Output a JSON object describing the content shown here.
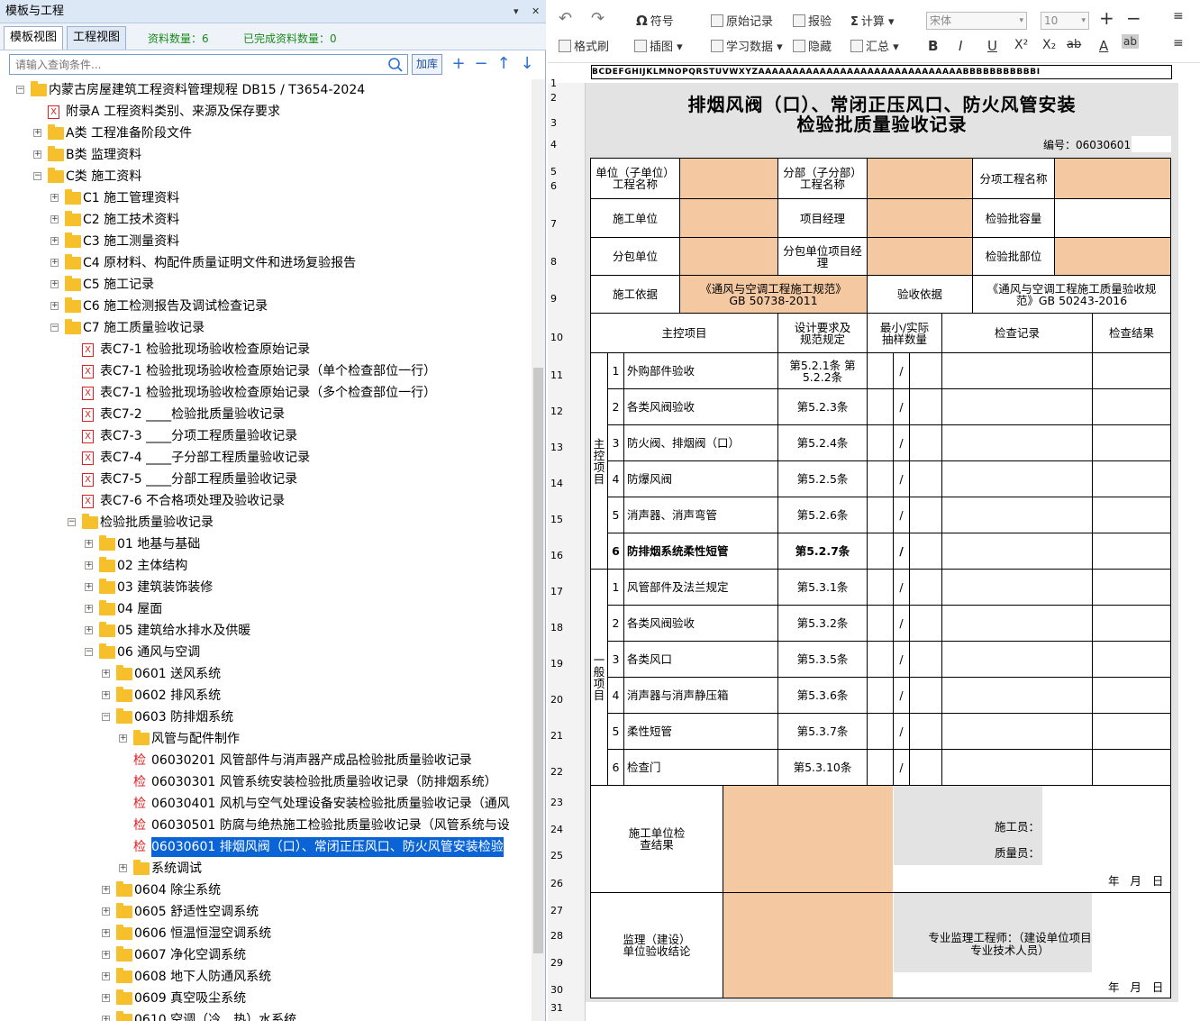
{
  "panel": {
    "title": "模板与工程",
    "pin": "▾",
    "close": "✕",
    "tabs": [
      "模板视图",
      "工程视图"
    ],
    "count_label": "资料数量：6",
    "done_label": "已完成资料数量：0"
  },
  "search": {
    "placeholder": "请输入查询条件...",
    "add_label": "加库"
  },
  "tree": [
    {
      "label": "内蒙古房屋建筑工程资料管理规程 DB15 / T3654-2024",
      "indent": 0,
      "kind": "folder",
      "exp": "−"
    },
    {
      "label": "附录A   工程资料类别、来源及保存要求",
      "indent": 1,
      "kind": "x",
      "exp": ""
    },
    {
      "label": "A类 工程准备阶段文件",
      "indent": 1,
      "kind": "folder",
      "exp": "+"
    },
    {
      "label": "B类 监理资料",
      "indent": 1,
      "kind": "folder",
      "exp": "+"
    },
    {
      "label": "C类 施工资料",
      "indent": 1,
      "kind": "folder",
      "exp": "−"
    },
    {
      "label": "C1  施工管理资料",
      "indent": 2,
      "kind": "folder",
      "exp": "+"
    },
    {
      "label": "C2  施工技术资料",
      "indent": 2,
      "kind": "folder",
      "exp": "+"
    },
    {
      "label": "C3  施工测量资料",
      "indent": 2,
      "kind": "folder",
      "exp": "+"
    },
    {
      "label": "C4  原材料、构配件质量证明文件和进场复验报告",
      "indent": 2,
      "kind": "folder",
      "exp": "+"
    },
    {
      "label": "C5  施工记录",
      "indent": 2,
      "kind": "folder",
      "exp": "+"
    },
    {
      "label": "C6  施工检测报告及调试检查记录",
      "indent": 2,
      "kind": "folder",
      "exp": "+"
    },
    {
      "label": "C7  施工质量验收记录",
      "indent": 2,
      "kind": "folder",
      "exp": "−"
    },
    {
      "label": "表C7-1  检验批现场验收检查原始记录",
      "indent": 3,
      "kind": "x",
      "exp": ""
    },
    {
      "label": "表C7-1  检验批现场验收检查原始记录（单个检查部位一行）",
      "indent": 3,
      "kind": "x",
      "exp": ""
    },
    {
      "label": "表C7-1  检验批现场验收检查原始记录（多个检查部位一行）",
      "indent": 3,
      "kind": "x",
      "exp": ""
    },
    {
      "label": "表C7-2  ____检验批质量验收记录",
      "indent": 3,
      "kind": "x",
      "exp": ""
    },
    {
      "label": "表C7-3  ____分项工程质量验收记录",
      "indent": 3,
      "kind": "x",
      "exp": ""
    },
    {
      "label": "表C7-4  ____子分部工程质量验收记录",
      "indent": 3,
      "kind": "x",
      "exp": ""
    },
    {
      "label": "表C7-5  ____分部工程质量验收记录",
      "indent": 3,
      "kind": "x",
      "exp": ""
    },
    {
      "label": "表C7-6  不合格项处理及验收记录",
      "indent": 3,
      "kind": "x",
      "exp": ""
    },
    {
      "label": "检验批质量验收记录",
      "indent": 3,
      "kind": "folder",
      "exp": "−"
    },
    {
      "label": "01  地基与基础",
      "indent": 4,
      "kind": "folder",
      "exp": "+"
    },
    {
      "label": "02  主体结构",
      "indent": 4,
      "kind": "folder",
      "exp": "+"
    },
    {
      "label": "03  建筑装饰装修",
      "indent": 4,
      "kind": "folder",
      "exp": "+"
    },
    {
      "label": "04  屋面",
      "indent": 4,
      "kind": "folder",
      "exp": "+"
    },
    {
      "label": "05  建筑给水排水及供暖",
      "indent": 4,
      "kind": "folder",
      "exp": "+"
    },
    {
      "label": "06  通风与空调",
      "indent": 4,
      "kind": "folder",
      "exp": "−"
    },
    {
      "label": "0601  送风系统",
      "indent": 5,
      "kind": "folder",
      "exp": "+"
    },
    {
      "label": "0602  排风系统",
      "indent": 5,
      "kind": "folder",
      "exp": "+"
    },
    {
      "label": "0603  防排烟系统",
      "indent": 5,
      "kind": "folder",
      "exp": "−"
    },
    {
      "label": "风管与配件制作",
      "indent": 6,
      "kind": "folder",
      "exp": "+"
    },
    {
      "label": "06030201  风管部件与消声器产成品检验批质量验收记录",
      "indent": 6,
      "kind": "jian",
      "exp": ""
    },
    {
      "label": "06030301  风管系统安装检验批质量验收记录（防排烟系统）",
      "indent": 6,
      "kind": "jian",
      "exp": ""
    },
    {
      "label": "06030401  风机与空气处理设备安装检验批质量验收记录（通风",
      "indent": 6,
      "kind": "jian",
      "exp": ""
    },
    {
      "label": "06030501  防腐与绝热施工检验批质量验收记录（风管系统与设",
      "indent": 6,
      "kind": "jian",
      "exp": ""
    },
    {
      "label": "06030601  排烟风阀（口）、常闭正压风口、防火风管安装检验",
      "indent": 6,
      "kind": "jian",
      "exp": "",
      "selected": true
    },
    {
      "label": "系统调试",
      "indent": 6,
      "kind": "folder",
      "exp": "+"
    },
    {
      "label": "0604  除尘系统",
      "indent": 5,
      "kind": "folder",
      "exp": "+"
    },
    {
      "label": "0605  舒适性空调系统",
      "indent": 5,
      "kind": "folder",
      "exp": "+"
    },
    {
      "label": "0606  恒温恒湿空调系统",
      "indent": 5,
      "kind": "folder",
      "exp": "+"
    },
    {
      "label": "0607  净化空调系统",
      "indent": 5,
      "kind": "folder",
      "exp": "+"
    },
    {
      "label": "0608  地下人防通风系统",
      "indent": 5,
      "kind": "folder",
      "exp": "+"
    },
    {
      "label": "0609  真空吸尘系统",
      "indent": 5,
      "kind": "folder",
      "exp": "+"
    },
    {
      "label": "0610  空调（冷、热）水系统",
      "indent": 5,
      "kind": "folder",
      "exp": "+"
    }
  ],
  "toolbar": {
    "undo": "↶",
    "redo": "↷",
    "symbol": "符号",
    "original": "原始记录",
    "report": "报验",
    "calc": "计算",
    "format_brush": "格式刷",
    "insert_image": "插图",
    "study": "学习数据",
    "hide": "隐藏",
    "summary": "汇总",
    "font": "宋体",
    "size": "10",
    "bold": "B",
    "italic": "I",
    "underline": "U",
    "sup": "X²",
    "sub": "X₂",
    "strike": "ab",
    "fcolor": "A",
    "spell": "ab"
  },
  "ruler": "BCDEFGHIJKLMNOPQRSTUVWXYZAAAAAAAAAAAAAAAAAAAAAAAAAAAAAABBBBBBBBBBBI",
  "rownums": [
    "1",
    "2",
    "3",
    "4",
    "5",
    "6",
    "7",
    "8",
    "9",
    "10",
    "11",
    "12",
    "13",
    "14",
    "15",
    "16",
    "17",
    "18",
    "19",
    "20",
    "21",
    "22",
    "23",
    "24",
    "25",
    "26",
    "27",
    "28",
    "29",
    "30",
    "31"
  ],
  "sheet": {
    "title1": "排烟风阀（口）、常闭正压风口、防火风管安装",
    "title2": "检验批质量验收记录",
    "code": "编号：06030601",
    "unit": "单位（子单位）工程名称",
    "subdiv": "分部（子分部）工程名称",
    "item": "分项工程名称",
    "constructor": "施工单位",
    "pm": "项目经理",
    "capacity": "检验批容量",
    "subcontractor": "分包单位",
    "sub_pm": "分包单位项目经理",
    "location": "检验批部位",
    "basis": "施工依据",
    "basis_val": "《通风与空调工程施工规范》GB 50738-2011",
    "accept_basis": "验收依据",
    "accept_val": "《通风与空调工程施工质量验收规范》GB 50243-2016",
    "h_main": "主控项目",
    "h_design": "设计要求及规范规定",
    "h_sample": "最小/实际抽样数量",
    "h_record": "检查记录",
    "h_result": "检查结果",
    "g_main": "主控项目",
    "g_general": "一般项目",
    "slash": "/",
    "main_items": [
      {
        "n": "1",
        "name": "外购部件验收",
        "spec": "第5.2.1条 第5.2.2条",
        "bold": false
      },
      {
        "n": "2",
        "name": "各类风阀验收",
        "spec": "第5.2.3条",
        "bold": false
      },
      {
        "n": "3",
        "name": "防火阀、排烟阀（口）",
        "spec": "第5.2.4条",
        "bold": false
      },
      {
        "n": "4",
        "name": "防爆风阀",
        "spec": "第5.2.5条",
        "bold": false
      },
      {
        "n": "5",
        "name": "消声器、消声弯管",
        "spec": "第5.2.6条",
        "bold": false
      },
      {
        "n": "6",
        "name": "防排烟系统柔性短管",
        "spec": "第5.2.7条",
        "bold": true
      }
    ],
    "gen_items": [
      {
        "n": "1",
        "name": "风管部件及法兰规定",
        "spec": "第5.3.1条"
      },
      {
        "n": "2",
        "name": "各类风阀验收",
        "spec": "第5.3.2条"
      },
      {
        "n": "3",
        "name": "各类风口",
        "spec": "第5.3.5条"
      },
      {
        "n": "4",
        "name": "消声器与消声静压箱",
        "spec": "第5.3.6条"
      },
      {
        "n": "5",
        "name": "柔性短管",
        "spec": "第5.3.7条"
      },
      {
        "n": "6",
        "name": "检查门",
        "spec": "第5.3.10条"
      }
    ],
    "c_result": "施工单位检查结果",
    "worker": "施工员：",
    "qc": "质量员：",
    "date": "年   月   日",
    "s_result": "监理（建设）单位验收结论",
    "engineer": "专业监理工程师：（建设单位项目专业技术人员）",
    "date2": "年   月   日"
  }
}
